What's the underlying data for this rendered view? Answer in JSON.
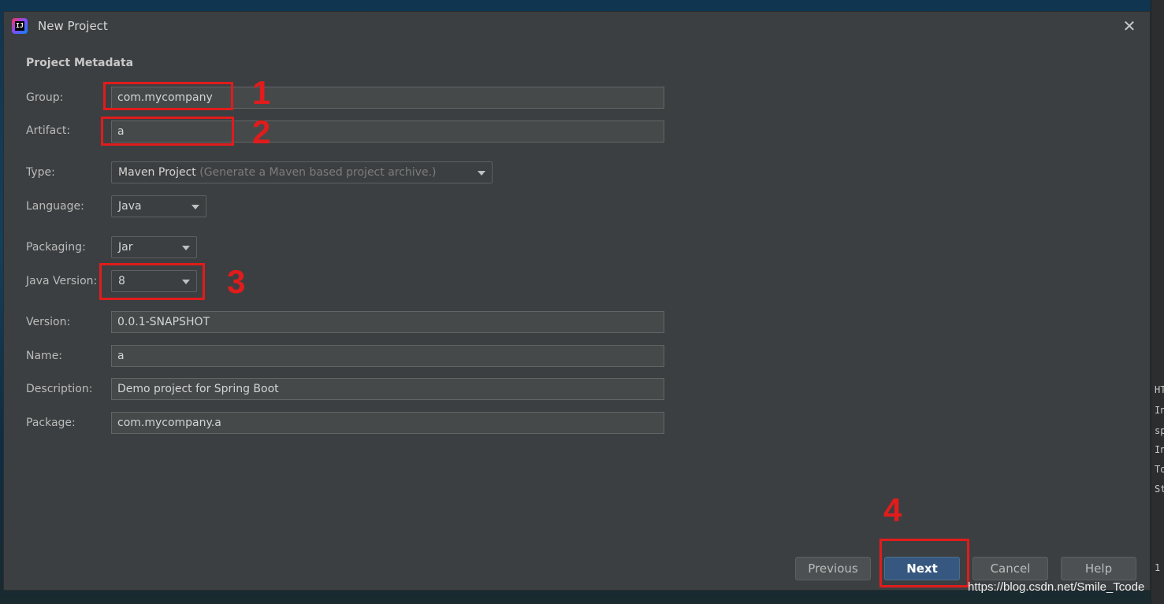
{
  "dialog": {
    "title": "New Project",
    "close_glyph": "✕",
    "section_title": "Project Metadata"
  },
  "fields": {
    "group": {
      "label": "Group:",
      "value": "com.mycompany"
    },
    "artifact": {
      "label": "Artifact:",
      "value": "a"
    },
    "type": {
      "label": "Type:",
      "value": "Maven Project",
      "hint": "(Generate a Maven based project archive.)"
    },
    "language": {
      "label": "Language:",
      "value": "Java"
    },
    "packaging": {
      "label": "Packaging:",
      "value": "Jar"
    },
    "java_version": {
      "label": "Java Version:",
      "value": "8"
    },
    "version": {
      "label": "Version:",
      "value": "0.0.1-SNAPSHOT"
    },
    "name": {
      "label": "Name:",
      "value": "a"
    },
    "description": {
      "label": "Description:",
      "value": "Demo project for Spring Boot"
    },
    "package": {
      "label": "Package:",
      "value": "com.mycompany.a"
    }
  },
  "buttons": {
    "previous": "Previous",
    "next": "Next",
    "cancel": "Cancel",
    "help": "Help"
  },
  "annotations": [
    "1",
    "2",
    "3",
    "4"
  ],
  "background_ide_text": [
    "HT",
    "In",
    "sp",
    "In",
    "To",
    "St",
    "1"
  ],
  "watermark": "https://blog.csdn.net/Smile_Tcode",
  "colors": {
    "dialog_bg": "#3c3f41",
    "annotation": "#e01c1c",
    "primary_button": "#365880"
  },
  "icons": {
    "app": "intellij-idea-icon",
    "close": "close-icon",
    "dropdown": "chevron-down-icon"
  }
}
